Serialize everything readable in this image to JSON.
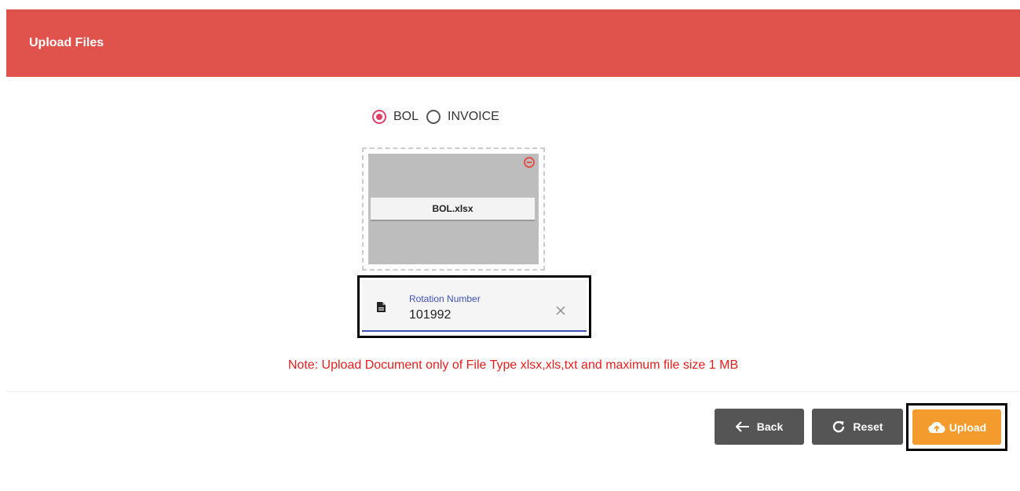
{
  "header": {
    "title": "Upload Files",
    "color": "#e0524c"
  },
  "document_type": {
    "options": [
      {
        "label": "BOL",
        "selected": true
      },
      {
        "label": "INVOICE",
        "selected": false
      }
    ]
  },
  "dropzone": {
    "file_name": "BOL.xlsx",
    "remove_icon": "remove-circle-icon"
  },
  "rotation_field": {
    "label": "Rotation Number",
    "value": "101992",
    "leading_icon": "document-icon",
    "trailing_icon": "close-icon"
  },
  "note": "Note: Upload Document only of File Type xlsx,xls,txt and maximum file size 1 MB",
  "actions": {
    "back_label": "Back",
    "reset_label": "Reset",
    "upload_label": "Upload",
    "back_color": "#555555",
    "upload_color": "#f39c2d"
  }
}
